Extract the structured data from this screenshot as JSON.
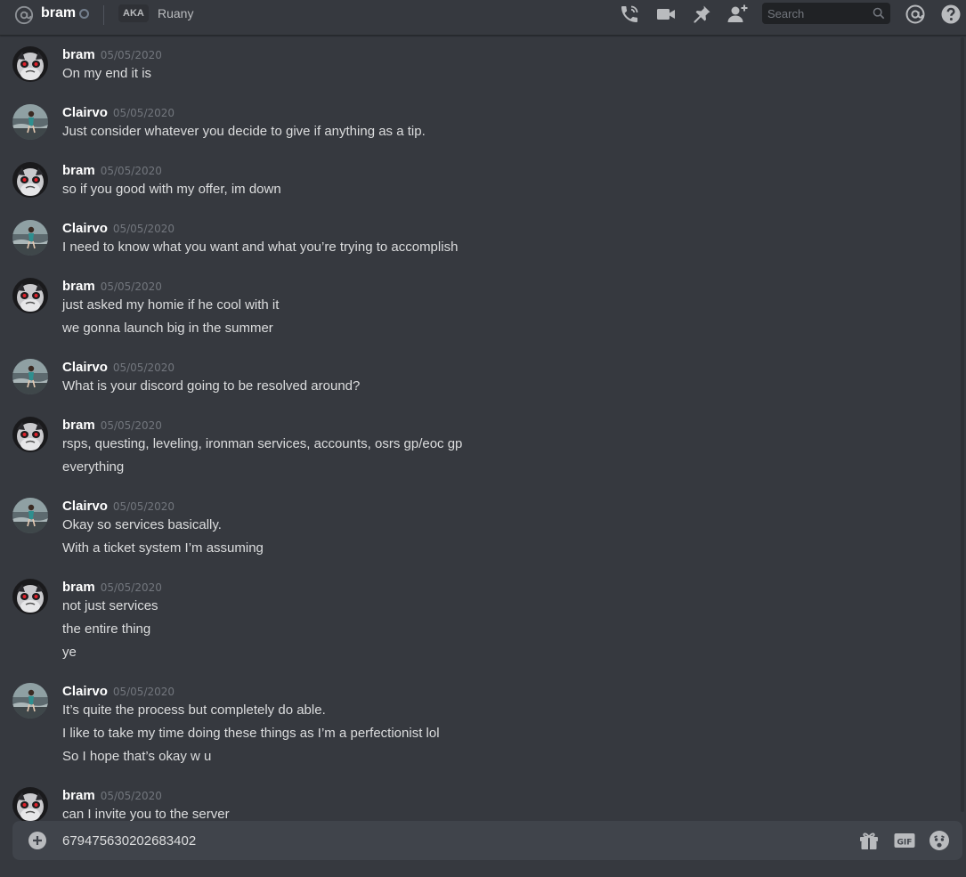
{
  "header": {
    "channel_name": "bram",
    "aka_label": "AKA",
    "aka_name": "Ruany",
    "search_placeholder": "Search"
  },
  "messages": [
    {
      "author": "bram",
      "avatar": "bram-avatar",
      "timestamp": "05/05/2020",
      "lines": [
        "On my end it is"
      ]
    },
    {
      "author": "Clairvo",
      "avatar": "clairvo-avatar",
      "timestamp": "05/05/2020",
      "lines": [
        "Just consider whatever you decide to give if anything as a tip."
      ]
    },
    {
      "author": "bram",
      "avatar": "bram-avatar",
      "timestamp": "05/05/2020",
      "lines": [
        "so if you good with my offer, im down"
      ]
    },
    {
      "author": "Clairvo",
      "avatar": "clairvo-avatar",
      "timestamp": "05/05/2020",
      "lines": [
        "I need to know what you want and what you’re trying to accomplish"
      ]
    },
    {
      "author": "bram",
      "avatar": "bram-avatar",
      "timestamp": "05/05/2020",
      "lines": [
        "just asked my homie if he cool with it",
        "we gonna launch big in the summer"
      ]
    },
    {
      "author": "Clairvo",
      "avatar": "clairvo-avatar",
      "timestamp": "05/05/2020",
      "lines": [
        "What is your discord going to be resolved around?"
      ]
    },
    {
      "author": "bram",
      "avatar": "bram-avatar",
      "timestamp": "05/05/2020",
      "lines": [
        "rsps, questing, leveling, ironman services, accounts, osrs gp/eoc gp",
        "everything"
      ]
    },
    {
      "author": "Clairvo",
      "avatar": "clairvo-avatar",
      "timestamp": "05/05/2020",
      "lines": [
        "Okay so services basically.",
        "With a ticket system I’m assuming"
      ]
    },
    {
      "author": "bram",
      "avatar": "bram-avatar",
      "timestamp": "05/05/2020",
      "lines": [
        "not just services",
        "the entire thing",
        "ye"
      ]
    },
    {
      "author": "Clairvo",
      "avatar": "clairvo-avatar",
      "timestamp": "05/05/2020",
      "lines": [
        "It’s quite the process but completely do able.",
        "I like to take my time doing these things as I’m a perfectionist lol",
        "So I hope that’s okay w u"
      ]
    },
    {
      "author": "bram",
      "avatar": "bram-avatar",
      "timestamp": "05/05/2020",
      "lines": [
        "can I invite you to the server"
      ]
    }
  ],
  "composer": {
    "value": "679475630202683402"
  },
  "colors": {
    "background": "#36393f",
    "composer_bg": "#40444b",
    "search_bg": "#202225",
    "text": "#dcddde",
    "muted": "#72767d",
    "icon": "#b9bbbe"
  }
}
